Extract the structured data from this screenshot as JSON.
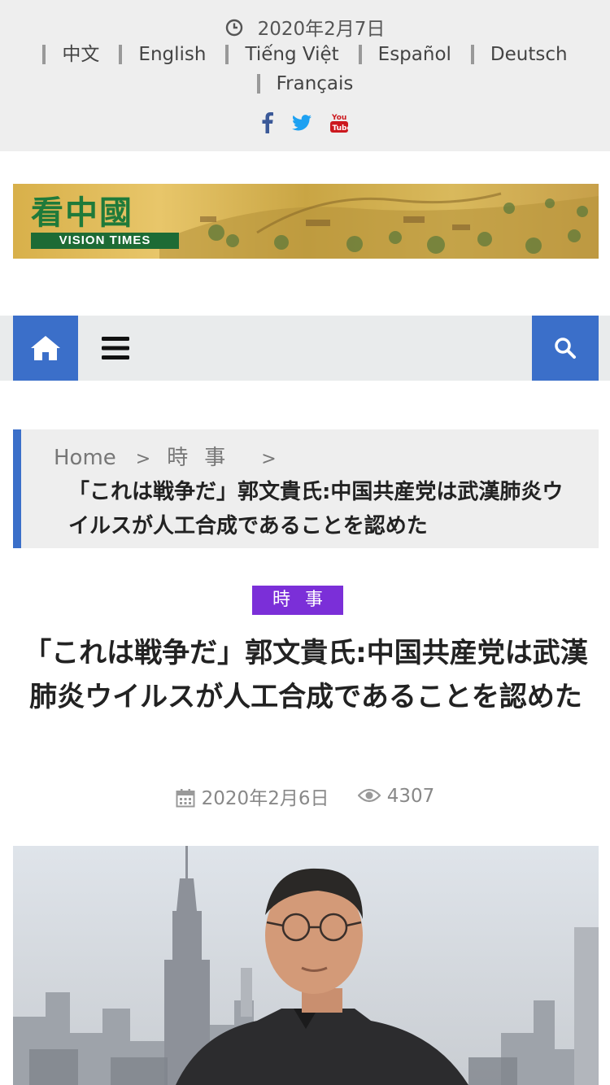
{
  "top": {
    "date": "2020年2月7日",
    "languages_row1": [
      "中文",
      "English",
      "Tiếng Việt",
      "Español",
      "Deutsch"
    ],
    "languages_row2": [
      "Français"
    ],
    "social": [
      {
        "icon": "facebook-icon",
        "color": "#3b5998"
      },
      {
        "icon": "twitter-icon",
        "color": "#1da1f2"
      },
      {
        "icon": "youtube-icon",
        "color": "#cc181e"
      }
    ]
  },
  "banner": {
    "logo_cn": "看中國",
    "logo_en": "VISION TIMES"
  },
  "nav": {
    "home_icon": "home-icon",
    "menu_icon": "hamburger-menu-icon",
    "search_icon": "search-icon",
    "accent": "#3b6fc9"
  },
  "breadcrumb": {
    "home": "Home",
    "separator": ">",
    "category": "時事",
    "title": "「これは戦争だ」郭文貴氏:中国共産党は武漢肺炎ウイルスが人工合成であることを認めた"
  },
  "article": {
    "category": "時事",
    "category_color": "#7b2fd8",
    "title": "「これは戦争だ」郭文貴氏:中国共産党は武漢肺炎ウイルスが人工合成であることを認めた",
    "date": "2020年2月6日",
    "views": "4307"
  }
}
